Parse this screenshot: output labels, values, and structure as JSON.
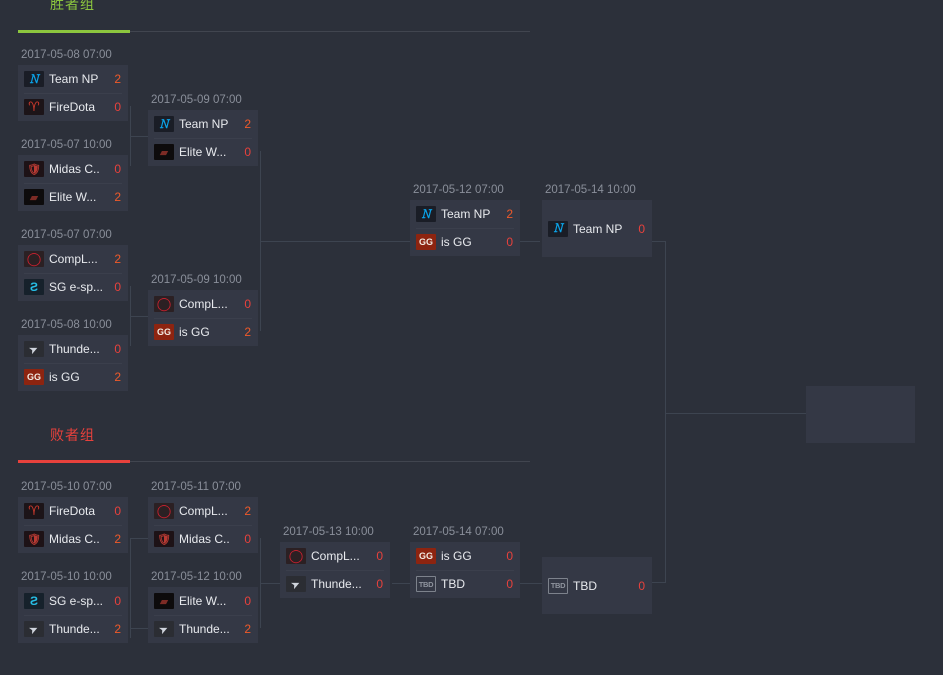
{
  "sections": {
    "winners": {
      "label": "胜者组",
      "accent": "#8cc63e"
    },
    "losers": {
      "label": "败者组",
      "accent": "#e8413c"
    }
  },
  "teams": {
    "np": {
      "name": "Team NP",
      "icon": "team-np-logo"
    },
    "fire": {
      "name": "FireDota",
      "icon": "firedota-logo"
    },
    "midas": {
      "name": "Midas C..",
      "icon": "midas-club-logo"
    },
    "elite": {
      "name": "Elite W...",
      "icon": "elite-wolves-logo"
    },
    "col": {
      "name": "CompL...",
      "icon": "complexity-logo"
    },
    "sg": {
      "name": "SG e-sp...",
      "icon": "sg-esports-logo"
    },
    "thunder": {
      "name": "Thunde...",
      "icon": "thunder-logo"
    },
    "gg": {
      "name": "is GG",
      "icon": "is-gg-logo"
    },
    "tbd": {
      "name": "TBD",
      "icon": "tbd-logo"
    }
  },
  "winners_bracket": {
    "wb_r1_m1": {
      "date": "2017-05-08 07:00",
      "top": {
        "name": "Team NP",
        "score": "2",
        "winner": true
      },
      "bottom": {
        "name": "FireDota",
        "score": "0",
        "winner": false
      }
    },
    "wb_r1_m2": {
      "date": "2017-05-07 10:00",
      "top": {
        "name": "Midas C..",
        "score": "0",
        "winner": false
      },
      "bottom": {
        "name": "Elite W...",
        "score": "2",
        "winner": true
      }
    },
    "wb_r1_m3": {
      "date": "2017-05-07 07:00",
      "top": {
        "name": "CompL...",
        "score": "2",
        "winner": true
      },
      "bottom": {
        "name": "SG e-sp...",
        "score": "0",
        "winner": false
      }
    },
    "wb_r1_m4": {
      "date": "2017-05-08 10:00",
      "top": {
        "name": "Thunde...",
        "score": "0",
        "winner": false
      },
      "bottom": {
        "name": "is GG",
        "score": "2",
        "winner": true
      }
    },
    "wb_r2_m1": {
      "date": "2017-05-09 07:00",
      "top": {
        "name": "Team NP",
        "score": "2",
        "winner": true
      },
      "bottom": {
        "name": "Elite W...",
        "score": "0",
        "winner": false
      }
    },
    "wb_r2_m2": {
      "date": "2017-05-09 10:00",
      "top": {
        "name": "CompL...",
        "score": "0",
        "winner": false
      },
      "bottom": {
        "name": "is GG",
        "score": "2",
        "winner": true
      }
    },
    "wb_r3_m1": {
      "date": "2017-05-12 07:00",
      "top": {
        "name": "Team NP",
        "score": "2",
        "winner": true
      },
      "bottom": {
        "name": "is GG",
        "score": "0",
        "winner": false
      }
    },
    "wb_final": {
      "date": "2017-05-14 10:00",
      "single": {
        "name": "Team NP",
        "score": "0",
        "winner": false
      }
    }
  },
  "losers_bracket": {
    "lb_r1_m1": {
      "date": "2017-05-10 07:00",
      "top": {
        "name": "FireDota",
        "score": "0",
        "winner": false
      },
      "bottom": {
        "name": "Midas C..",
        "score": "2",
        "winner": true
      }
    },
    "lb_r1_m2": {
      "date": "2017-05-10 10:00",
      "top": {
        "name": "SG e-sp...",
        "score": "0",
        "winner": false
      },
      "bottom": {
        "name": "Thunde...",
        "score": "2",
        "winner": true
      }
    },
    "lb_r2_m1": {
      "date": "2017-05-11 07:00",
      "top": {
        "name": "CompL...",
        "score": "2",
        "winner": true
      },
      "bottom": {
        "name": "Midas C..",
        "score": "0",
        "winner": false
      }
    },
    "lb_r2_m2": {
      "date": "2017-05-12 10:00",
      "top": {
        "name": "Elite W...",
        "score": "0",
        "winner": false
      },
      "bottom": {
        "name": "Thunde...",
        "score": "2",
        "winner": true
      }
    },
    "lb_r3_m1": {
      "date": "2017-05-13 10:00",
      "top": {
        "name": "CompL...",
        "score": "0",
        "winner": false
      },
      "bottom": {
        "name": "Thunde...",
        "score": "0",
        "winner": false
      }
    },
    "lb_r4_m1": {
      "date": "2017-05-14 07:00",
      "top": {
        "name": "is GG",
        "score": "0",
        "winner": false
      },
      "bottom": {
        "name": "TBD",
        "score": "0",
        "winner": false
      }
    },
    "lb_final": {
      "date": "",
      "single": {
        "name": "TBD",
        "score": "0",
        "winner": false
      }
    }
  },
  "grand_final": {
    "date": "",
    "placeholder": true
  },
  "colors": {
    "page_bg": "#2c303a",
    "box_bg": "#343845",
    "score": "#e8413c",
    "score_win": "#ef5a2a",
    "team_name": "#e8eaee",
    "date": "#8a8f9a",
    "connector": "#3d4450"
  }
}
